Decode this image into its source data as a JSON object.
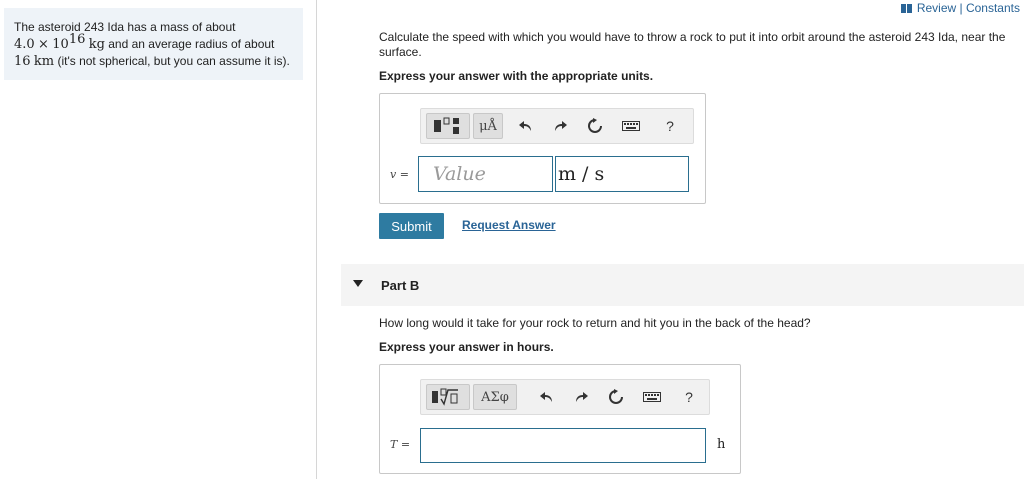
{
  "header": {
    "review_constants": "Review | Constants"
  },
  "problem": {
    "line1": "The asteroid 243 Ida has a mass of about",
    "mass_mantissa": "4.0",
    "times": "×",
    "mass_base": "10",
    "mass_exp": "16",
    "mass_unit": "kg",
    "line2_rest": " and an average radius of about",
    "radius_value": "16",
    "radius_unit": "km",
    "line3_rest": " (it's not spherical, but you can assume it is)."
  },
  "part_a": {
    "question": "Calculate the speed with which you would have to throw a rock to put it into orbit around the asteroid 243 Ida, near the surface.",
    "instruction": "Express your answer with the appropriate units.",
    "variable": "v =",
    "value_placeholder": "Value",
    "unit_value": "m / s",
    "toolbar_units_label": "μÅ",
    "help": "?",
    "submit": "Submit",
    "request_answer": "Request Answer"
  },
  "part_b": {
    "label": "Part B",
    "question": "How long would it take for your rock to return and hit you in the back of the head?",
    "instruction": "Express your answer in hours.",
    "variable": "T =",
    "unit": "h",
    "toolbar_greek_label": "ΑΣφ",
    "help": "?"
  }
}
